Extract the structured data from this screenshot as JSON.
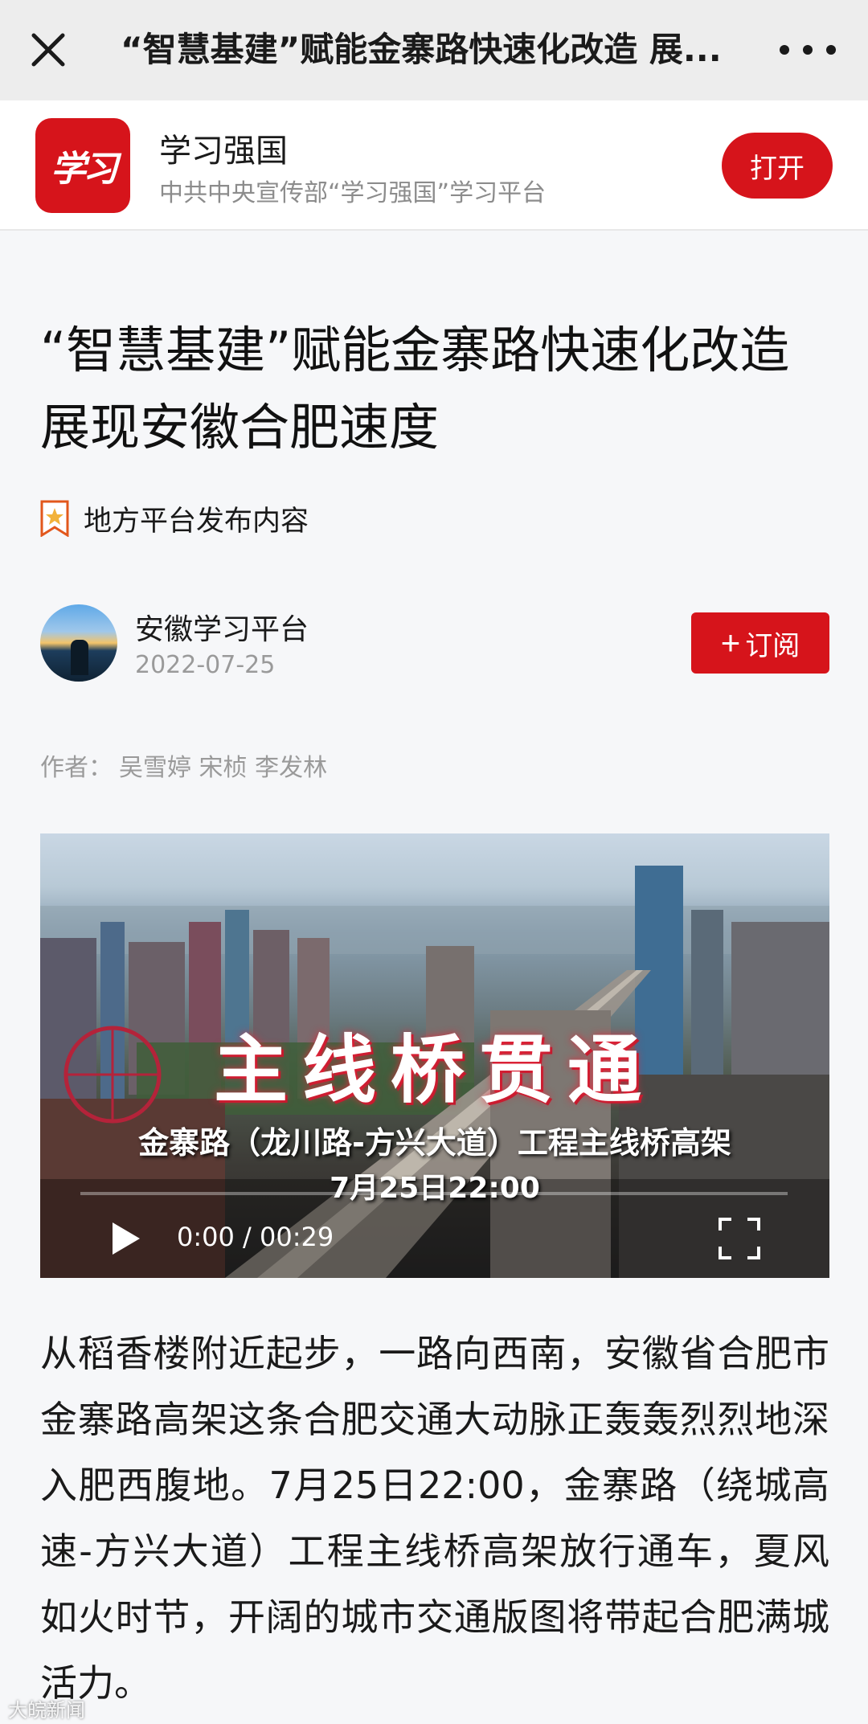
{
  "topbar": {
    "title": "“智慧基建”赋能金寨路快速化改造 展..."
  },
  "app_banner": {
    "logo_text": "学习",
    "name": "学习强国",
    "description": "中共中央宣传部“学习强国”学习平台",
    "open_label": "打开"
  },
  "article": {
    "title": "“智慧基建”赋能金寨路快速化改造展现安徽合肥速度",
    "source_label": "地方平台发布内容",
    "channel_name": "安徽学习平台",
    "publish_date": "2022-07-25",
    "subscribe_label": "订阅",
    "authors_prefix": "作者：",
    "authors": "吴雪婷 宋桢 李发林",
    "body": "从稻香楼附近起步，一路向西南，安徽省合肥市金寨路高架这条合肥交通大动脉正轰轰烈烈地深入肥西腹地。7月25日22:00，金寨路（绕城高速-方兴大道）工程主线桥高架放行通车，夏风如火时节，开阔的城市交通版图将带起合肥满城活力。"
  },
  "video": {
    "headline": "主线桥贯通",
    "subhead": "金寨路（龙川路-方兴大道）工程主线桥高架",
    "overlay_time": "7月25日22:00",
    "playback_time": "0:00 / 00:29",
    "progress": 0
  },
  "watermark": "大皖新闻",
  "colors": {
    "brand_red": "#d6141b",
    "nav_bg": "#ededed",
    "page_bg": "#f6f7f9"
  },
  "icons": [
    "close-icon",
    "more-icon",
    "source-star-icon",
    "plus-icon",
    "play-icon",
    "fullscreen-icon"
  ]
}
